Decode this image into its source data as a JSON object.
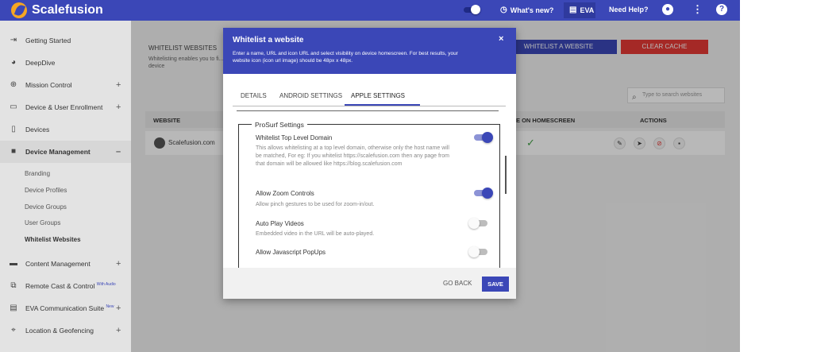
{
  "colors": {
    "brand": "#3b47b7",
    "danger": "#e53935",
    "success": "#43a047"
  },
  "topbar": {
    "brand": "Scalefusion",
    "whats_new": "What's new?",
    "eva": "EVA",
    "need_help": "Need Help?"
  },
  "sidebar": {
    "items": [
      {
        "label": "Getting Started",
        "icon": "login-icon"
      },
      {
        "label": "DeepDive",
        "icon": "dashboard-icon"
      },
      {
        "label": "Mission Control",
        "icon": "globe-icon",
        "expand": "+"
      },
      {
        "label": "Device & User Enrollment",
        "icon": "devices-icon",
        "expand": "+"
      },
      {
        "label": "Devices",
        "icon": "phone-icon"
      },
      {
        "label": "Device Management",
        "icon": "briefcase-icon",
        "expand": "–"
      },
      {
        "label": "Content Management",
        "icon": "folder-icon",
        "expand": "+"
      },
      {
        "label": "Remote Cast & Control",
        "icon": "cast-icon",
        "badge": "With Audio"
      },
      {
        "label": "EVA Communication Suite",
        "icon": "chat-icon",
        "badge": "New",
        "expand": "+"
      },
      {
        "label": "Location & Geofencing",
        "icon": "location-icon",
        "expand": "+"
      }
    ],
    "sub_items": [
      "Branding",
      "Device Profiles",
      "Device Groups",
      "User Groups",
      "Whitelist Websites"
    ]
  },
  "page": {
    "title": "WHITELIST WEBSITES",
    "subtitle_visible": "Whitelisting enables you to fi... device",
    "btn_whitelist": "WHITELIST A WEBSITE",
    "btn_clear": "CLEAR CACHE",
    "search_placeholder": "Type to search websites",
    "table": {
      "headers": [
        "WEBSITE",
        "E ON HOMESCREEN",
        "ACTIONS"
      ],
      "rows": [
        {
          "website": "Scalefusion.com"
        }
      ]
    }
  },
  "modal": {
    "title": "Whitelist a website",
    "description": "Enter a name, URL and icon URL and select visibility on device homescreen. For best results, your website icon (icon url image) should be 48px x 48px.",
    "close": "×",
    "tabs": [
      "DETAILS",
      "ANDROID SETTINGS",
      "APPLE SETTINGS"
    ],
    "active_tab": 2,
    "section_title": "ProSurf Settings",
    "settings": [
      {
        "title": "Whitelist Top Level Domain",
        "desc": "This allows whitelisting at a top level domain, otherwise only the host name will be matched, For eg: If you whitelist https://scalefusion.com then any page from that domain will be allowed like https://blog.scalefusion.com",
        "enabled": true
      },
      {
        "title": "Allow Zoom Controls",
        "desc": "Allow pinch gestures to be used for zoom-in/out.",
        "enabled": true
      },
      {
        "title": "Auto Play Videos",
        "desc": "Embedded video in the URL will be auto-played.",
        "enabled": false
      },
      {
        "title": "Allow Javascript PopUps",
        "desc": "",
        "enabled": false
      }
    ],
    "go_back": "GO BACK",
    "save": "SAVE"
  }
}
